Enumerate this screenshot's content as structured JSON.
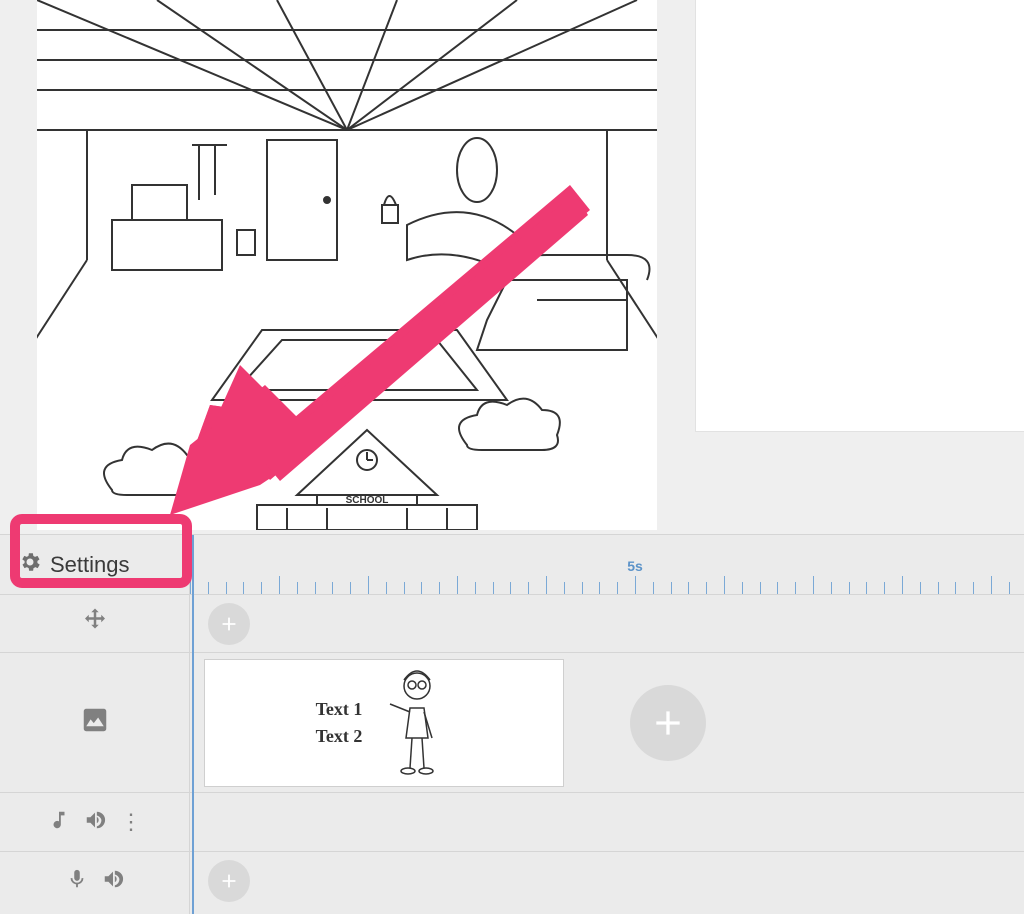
{
  "scene": {
    "school_label": "SCHOOL"
  },
  "settings": {
    "label": "Settings"
  },
  "ruler": {
    "label_5s": "5s"
  },
  "clip": {
    "text1": "Text 1",
    "text2": "Text 2"
  },
  "annotation": {
    "arrow_color": "#ee3a72"
  }
}
